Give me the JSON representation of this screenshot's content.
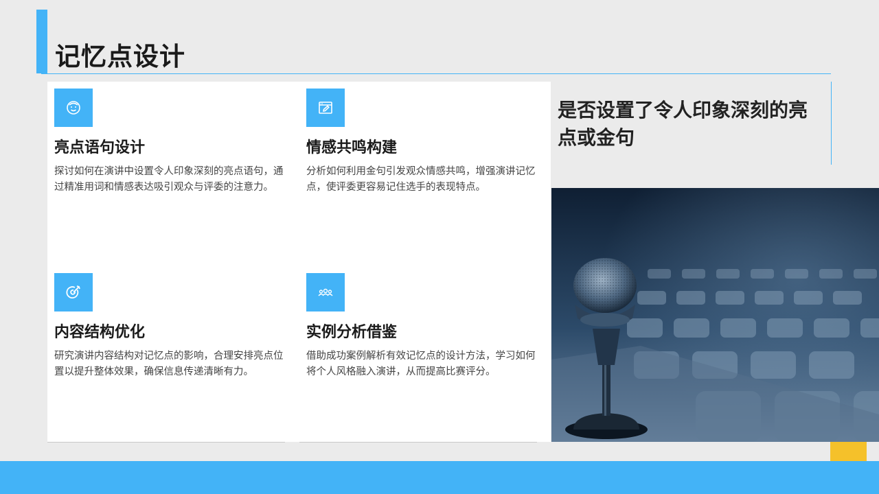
{
  "slide": {
    "title": "记忆点设计",
    "quote": "是否设置了令人印象深刻的亮点或金句"
  },
  "cards": [
    {
      "icon": "smiley-face-icon",
      "title": "亮点语句设计",
      "desc": "探讨如何在演讲中设置令人印象深刻的亮点语句，通过精准用词和情感表达吸引观众与评委的注意力。"
    },
    {
      "icon": "edit-window-icon",
      "title": "情感共鸣构建",
      "desc": "分析如何利用金句引发观众情感共鸣，增强演讲记忆点，使评委更容易记住选手的表现特点。"
    },
    {
      "icon": "target-arrow-icon",
      "title": "内容结构优化",
      "desc": "研究演讲内容结构对记忆点的影响，合理安排亮点位置以提升整体效果，确保信息传递清晰有力。"
    },
    {
      "icon": "people-group-icon",
      "title": "实例分析借鉴",
      "desc": "借助成功案例解析有效记忆点的设计方法，学习如何将个人风格融入演讲，从而提高比赛评分。"
    }
  ],
  "photo": {
    "subject": "microphone-in-auditorium"
  },
  "colors": {
    "accent": "#43b3f7",
    "highlight": "#f5c12a",
    "panel": "#ffffff",
    "background": "#ebebeb"
  }
}
